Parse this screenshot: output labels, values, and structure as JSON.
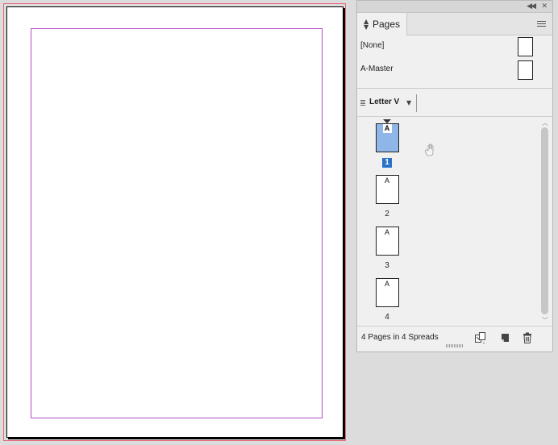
{
  "panel": {
    "tab_label": "Pages",
    "masters": [
      {
        "name": "[None]"
      },
      {
        "name": "A-Master"
      }
    ],
    "page_size_label": "Letter V",
    "pages": [
      {
        "number": "1",
        "master": "A",
        "selected": true
      },
      {
        "number": "2",
        "master": "A",
        "selected": false
      },
      {
        "number": "3",
        "master": "A",
        "selected": false
      },
      {
        "number": "4",
        "master": "A",
        "selected": false
      }
    ],
    "status_text": "4 Pages in 4 Spreads"
  },
  "colors": {
    "selected_page_fill": "#8fb6e8",
    "selected_number_bg": "#2a72c9",
    "margin_guide": "#b54dc4",
    "bleed_guide": "#e86a7a"
  },
  "icons": {
    "collapse": "double-chevron-left-icon",
    "close": "close-icon",
    "panel_menu": "hamburger-menu-icon",
    "edit_page_size": "edit-page-size-icon",
    "new_page": "new-page-icon",
    "delete": "trash-icon"
  }
}
